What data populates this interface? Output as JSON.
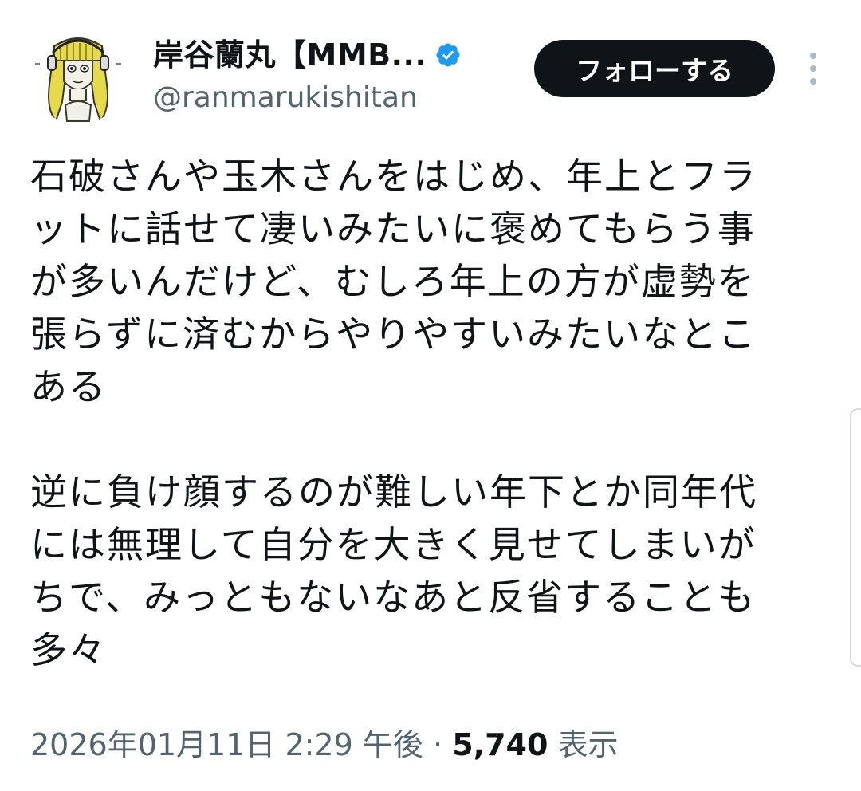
{
  "author": {
    "display_name": "岸谷蘭丸【MMB...",
    "handle": "@ranmarukishitan",
    "verified": true,
    "avatar_icon": "illustrated-avatar-icon"
  },
  "actions": {
    "follow_label": "フォローする",
    "more_icon": "more-vertical-icon"
  },
  "tweet": {
    "paragraphs": [
      [
        "石破さんや玉木さんをはじめ、年上とフラ",
        "ットに話せて凄いみたいに褒めてもらう事",
        "が多いんだけど、むしろ年上の方が虚勢を",
        "張らずに済むからやりやすいみたいなとこ",
        "ある"
      ],
      [
        "逆に負け顔するのが難しい年下とか同年代",
        "には無理して自分を大きく見せてしまいが",
        "ちで、みっともないなあと反省することも",
        "多々"
      ]
    ]
  },
  "meta": {
    "timestamp": "2026年01月11日 2:29 午後",
    "separator": "·",
    "views_count": "5,740",
    "views_label": "表示"
  },
  "colors": {
    "text": "#0f1419",
    "secondary": "#536471",
    "verified_blue": "#1d9bf0",
    "button_bg": "#0f1419"
  }
}
